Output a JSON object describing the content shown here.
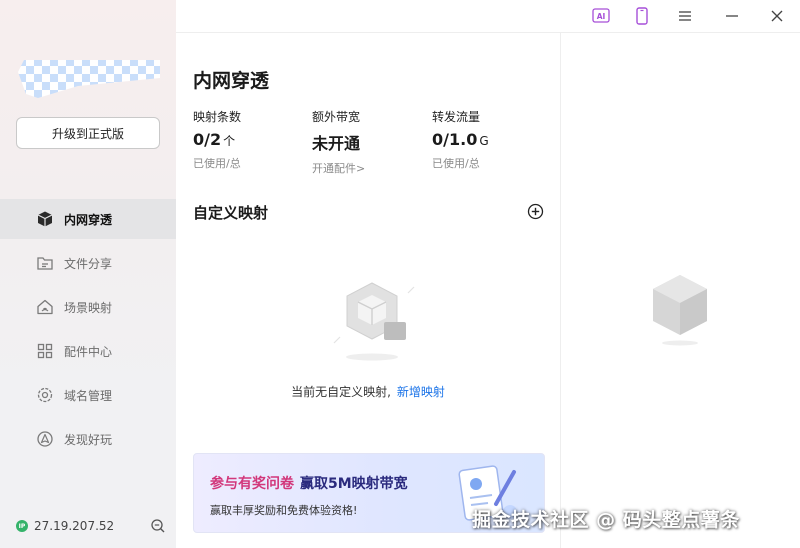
{
  "sidebar": {
    "upgrade_label": "升级到正式版",
    "items": [
      {
        "label": "内网穿透",
        "icon": "cube-icon",
        "active": true
      },
      {
        "label": "文件分享",
        "icon": "folder-share-icon"
      },
      {
        "label": "场景映射",
        "icon": "home-icon"
      },
      {
        "label": "配件中心",
        "icon": "grid-icon"
      },
      {
        "label": "域名管理",
        "icon": "domain-settings-icon"
      },
      {
        "label": "发现好玩",
        "icon": "discover-icon"
      }
    ],
    "ip_badge": "IP",
    "ip": "27.19.207.52"
  },
  "titlebar": {
    "ai_label": "AI"
  },
  "main": {
    "title": "内网穿透",
    "stats": [
      {
        "label": "映射条数",
        "value": "0/2",
        "unit": "个",
        "sub": "已使用/总"
      },
      {
        "label": "额外带宽",
        "value": "未开通",
        "unit": "",
        "sub": "开通配件>"
      },
      {
        "label": "转发流量",
        "value": "0/1.0",
        "unit": "G",
        "sub": "已使用/总"
      }
    ],
    "section_title": "自定义映射",
    "empty_text": "当前无自定义映射,",
    "empty_link": "新增映射",
    "banner": {
      "title_highlight": "参与有奖问卷",
      "title_rest": "赢取5M映射带宽",
      "subtitle": "赢取丰厚奖励和免费体验资格!"
    }
  },
  "watermark": "掘金技术社区 @ 码头整点薯条",
  "colors": {
    "accent_link": "#1a73e8",
    "banner_highlight": "#d2377b",
    "ip_green": "#35b36a"
  }
}
